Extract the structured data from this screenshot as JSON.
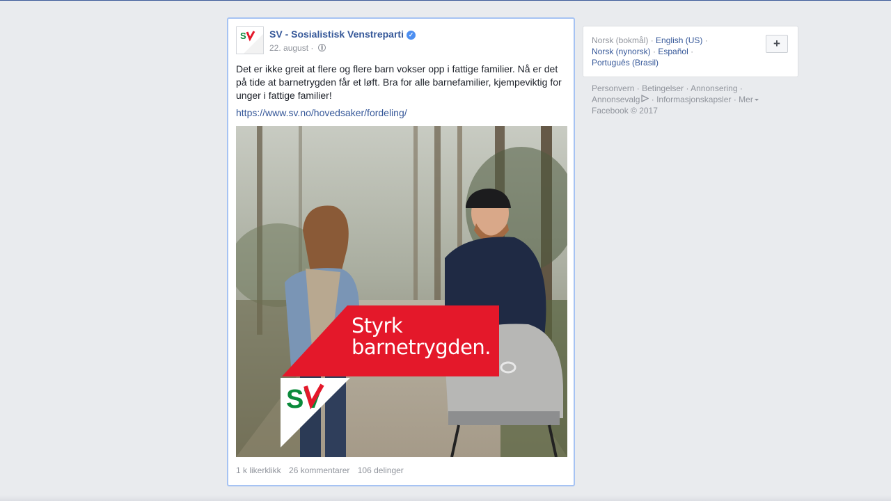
{
  "post": {
    "page_name": "SV - Sosialistisk Venstreparti",
    "avatar_text": "SV",
    "date": "22. august",
    "date_separator": "·",
    "text": "Det er ikke greit at flere og flere barn vokser opp i fattige familier. Nå er det på tide at barnetrygden får et løft. Bra for alle barnefamilier, kjempeviktig for unger i fattige familier!",
    "link": "https://www.sv.no/hovedsaker/fordeling/",
    "image": {
      "banner_line1": "Styrk",
      "banner_line2": "barnetrygden.",
      "logo_text": "SV"
    },
    "stats": {
      "likes": "1 k likerklikk",
      "comments": "26 kommentarer",
      "shares": "106 delinger"
    },
    "icons": [
      "verified-badge-icon",
      "globe-icon"
    ]
  },
  "languages": {
    "current": "Norsk (bokmål)",
    "links": [
      "English (US)",
      "Norsk (nynorsk)",
      "Español",
      "Português (Brasil)"
    ],
    "separator": "·",
    "add_button": "+"
  },
  "footer": {
    "links": [
      "Personvern",
      "Betingelser",
      "Annonsering",
      "Annonsevalg",
      "Informasjonskapsler",
      "Mer"
    ],
    "separator": "·",
    "copyright": "Facebook © 2017"
  },
  "colors": {
    "background": "#e9ebee",
    "link": "#365899",
    "muted": "#90949c",
    "banner_red": "#e4182a",
    "sv_green": "#0a8a3a",
    "post_border": "#a6c3f3"
  }
}
